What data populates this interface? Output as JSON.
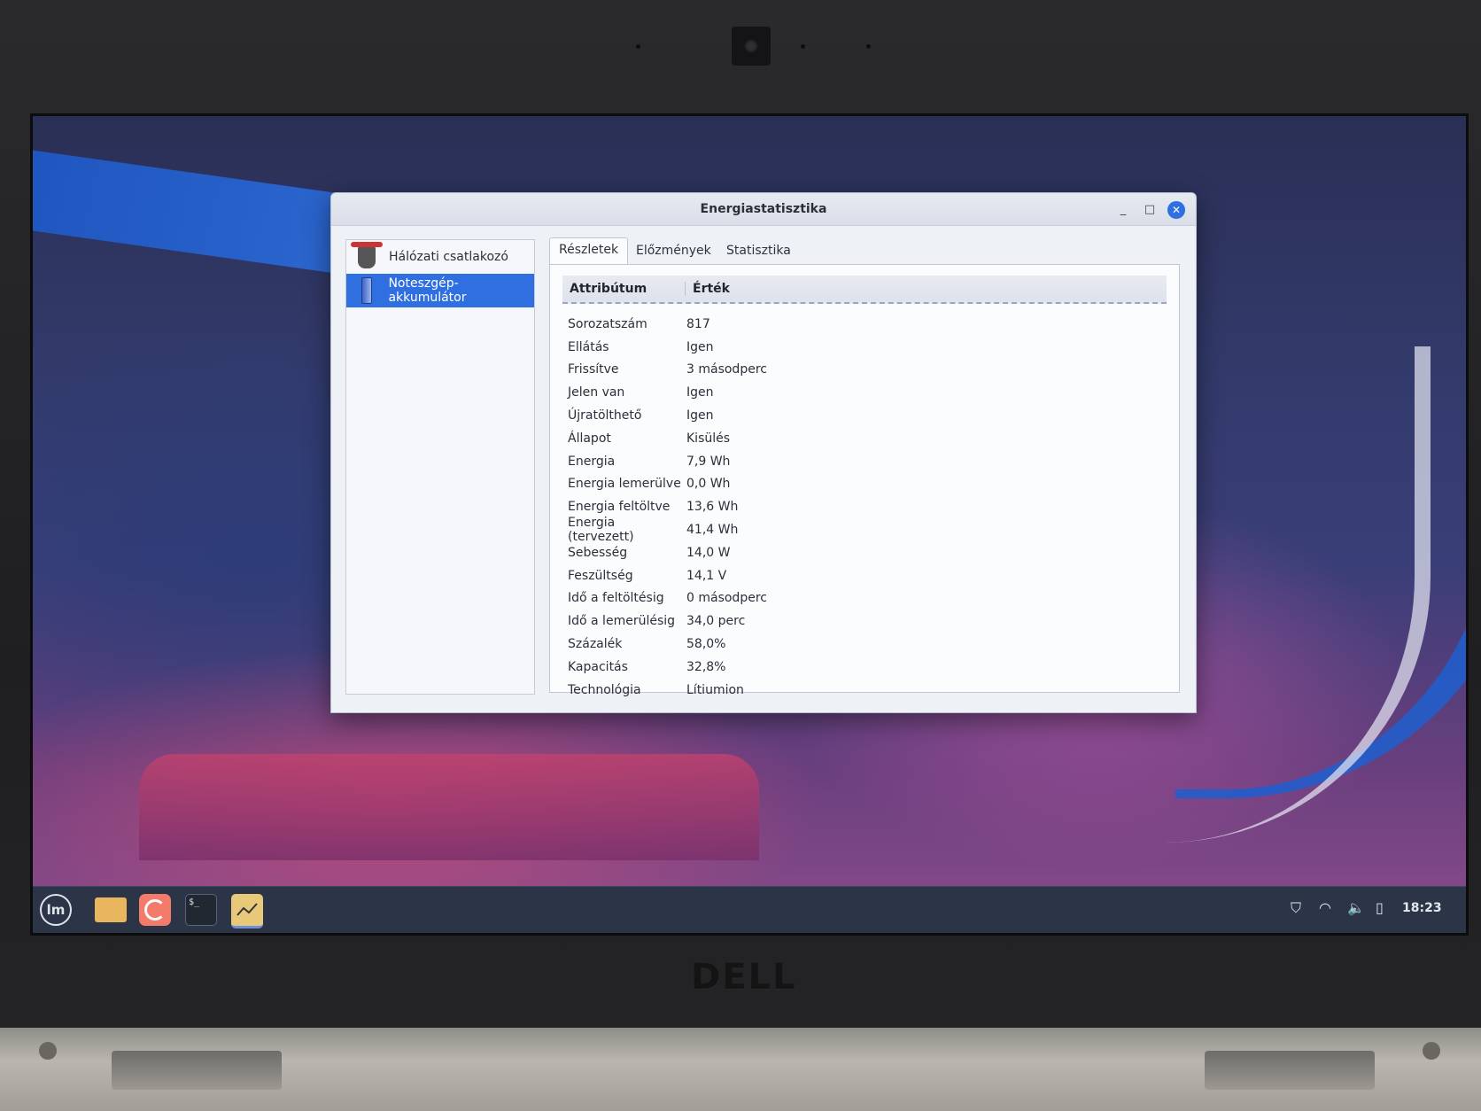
{
  "window": {
    "title": "Energiastatisztika",
    "min_label": "_",
    "max_label": "□",
    "close_label": "✕"
  },
  "sidebar": {
    "items": [
      {
        "label": "Hálózati csatlakozó",
        "icon": "power-plug-icon"
      },
      {
        "label": "Noteszgép-akkumulátor",
        "icon": "battery-icon",
        "selected": true
      }
    ]
  },
  "tabs": [
    {
      "label": "Részletek",
      "active": true
    },
    {
      "label": "Előzmények"
    },
    {
      "label": "Statisztika"
    }
  ],
  "table": {
    "headers": {
      "attribute": "Attribútum",
      "value": "Érték"
    },
    "rows": [
      {
        "attr": "Sorozatszám",
        "value": "817"
      },
      {
        "attr": "Ellátás",
        "value": "Igen"
      },
      {
        "attr": "Frissítve",
        "value": "3 másodperc"
      },
      {
        "attr": "Jelen van",
        "value": "Igen"
      },
      {
        "attr": "Újratölthető",
        "value": "Igen"
      },
      {
        "attr": "Állapot",
        "value": "Kisülés"
      },
      {
        "attr": "Energia",
        "value": "7,9 Wh"
      },
      {
        "attr": "Energia lemerülve",
        "value": "0,0 Wh"
      },
      {
        "attr": "Energia feltöltve",
        "value": "13,6 Wh"
      },
      {
        "attr": "Energia (tervezett)",
        "value": "41,4 Wh"
      },
      {
        "attr": "Sebesség",
        "value": "14,0 W"
      },
      {
        "attr": "Feszültség",
        "value": "14,1 V"
      },
      {
        "attr": "Idő a feltöltésig",
        "value": "0 másodperc"
      },
      {
        "attr": "Idő a lemerülésig",
        "value": "34,0 perc"
      },
      {
        "attr": "Százalék",
        "value": "58,0%"
      },
      {
        "attr": "Kapacitás",
        "value": "32,8%"
      },
      {
        "attr": "Technológia",
        "value": "Lítiumion"
      }
    ]
  },
  "taskbar": {
    "menu_label": "lm",
    "terminal_label": "$_",
    "clock": "18:23",
    "tray_icons": [
      "shield-icon",
      "wifi-icon",
      "volume-icon",
      "battery-icon"
    ]
  },
  "hardware": {
    "brand": "DELL"
  },
  "colors": {
    "accent": "#2f6fe0",
    "taskbar": "#2c3548"
  }
}
